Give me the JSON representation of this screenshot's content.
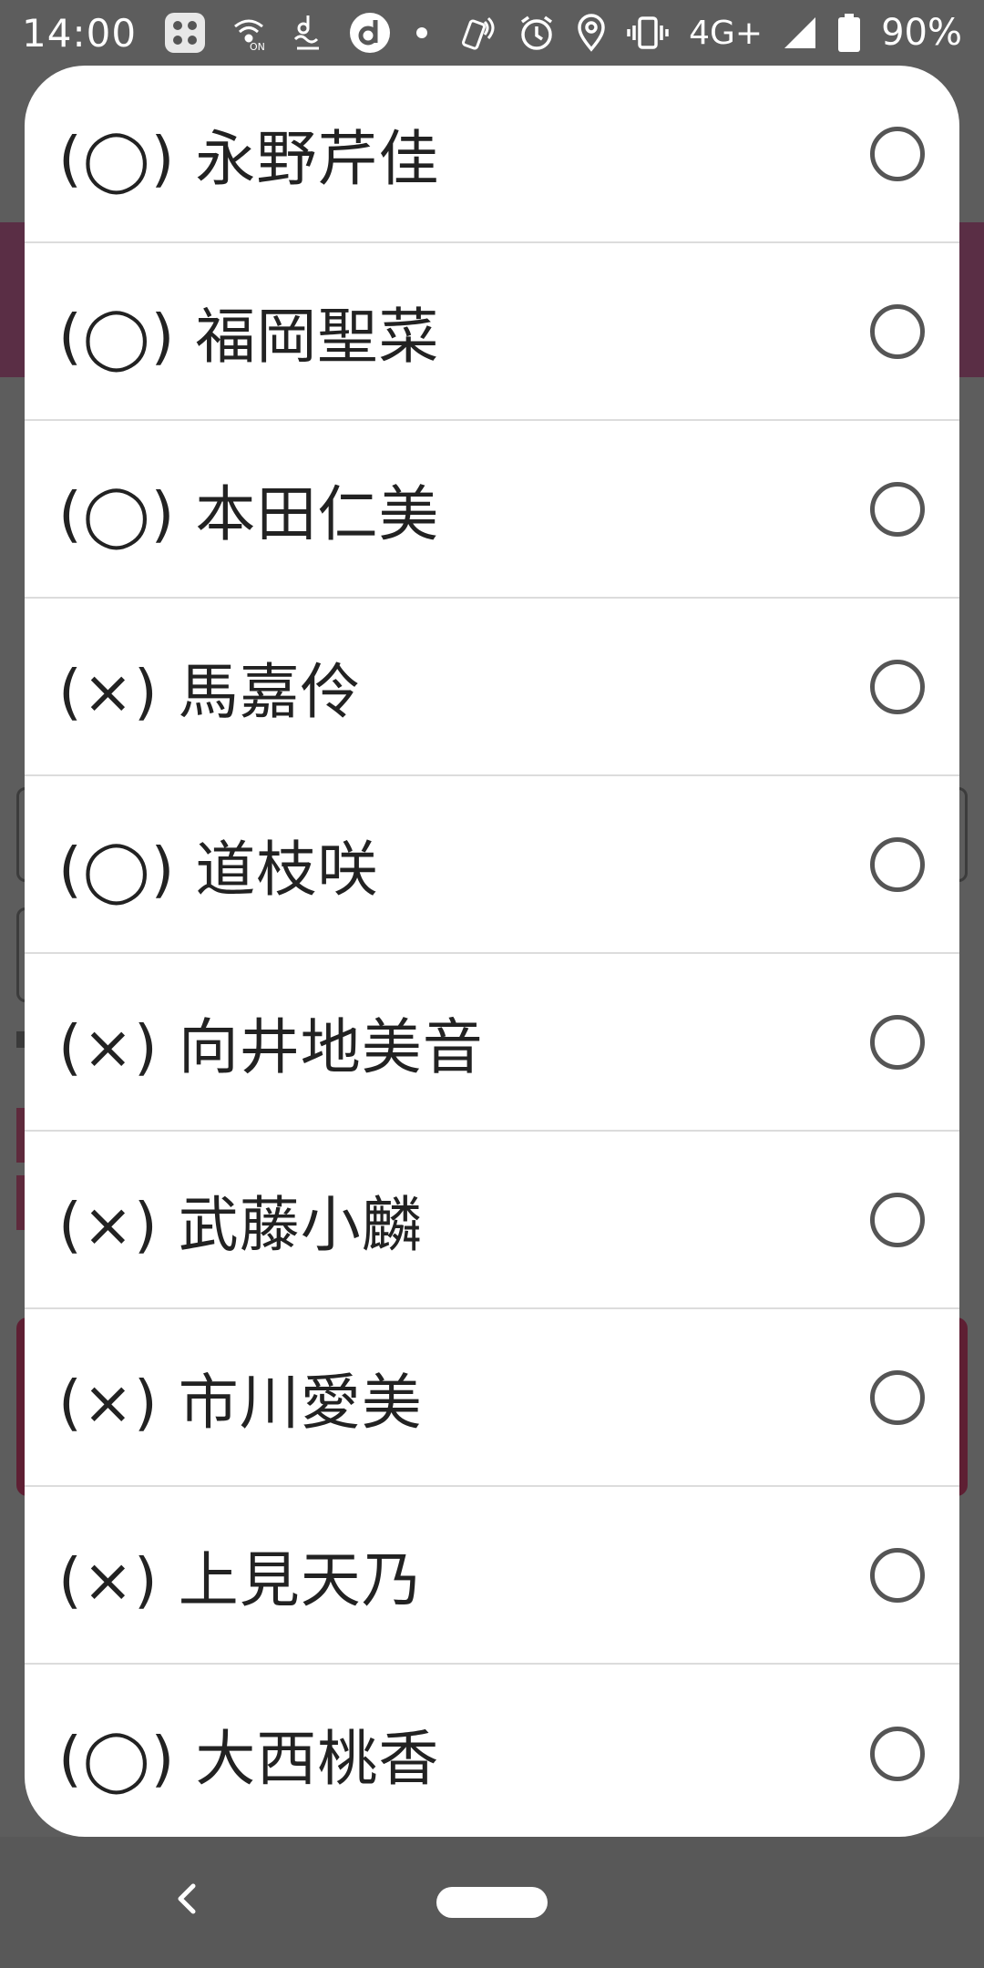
{
  "status_bar": {
    "time": "14:00",
    "network": "4G+",
    "battery": "90%",
    "left_icons": [
      "apps-grid-icon",
      "wifi-calling-icon",
      "d-music-icon",
      "d-menu-icon",
      "dot-icon"
    ],
    "right_icons": [
      "nfc-icon",
      "alarm-icon",
      "location-icon",
      "vibrate-icon",
      "signal-icon",
      "battery-icon"
    ]
  },
  "dialog": {
    "options": [
      {
        "label": "(◯) 永野芹佳",
        "selected": false
      },
      {
        "label": "(◯) 福岡聖菜",
        "selected": false
      },
      {
        "label": "(◯) 本田仁美",
        "selected": false
      },
      {
        "label": "(×) 馬嘉伶",
        "selected": false
      },
      {
        "label": "(◯) 道枝咲",
        "selected": false
      },
      {
        "label": "(×) 向井地美音",
        "selected": false
      },
      {
        "label": "(×) 武藤小麟",
        "selected": false
      },
      {
        "label": "(×) 市川愛美",
        "selected": false
      },
      {
        "label": "(×) 上見天乃",
        "selected": false
      },
      {
        "label": "(◯) 大西桃香",
        "selected": false
      }
    ]
  },
  "nav_bar": {
    "icons": [
      "back-icon",
      "home-pill"
    ]
  },
  "colors": {
    "scrim": "#5d5d5d",
    "dialog_bg": "#ffffff",
    "text": "#222222",
    "radio_border": "#555555",
    "divider": "#dcdcdc"
  }
}
